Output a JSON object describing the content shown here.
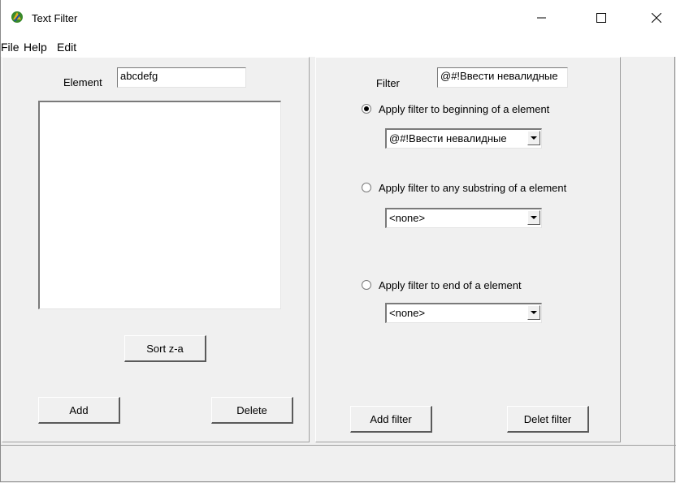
{
  "window": {
    "title": "Text Filter",
    "controls": {
      "minimize": "—",
      "maximize": "☐",
      "close": "✕"
    }
  },
  "menu": [
    "File",
    "Help",
    "Edit"
  ],
  "left": {
    "element_label": "Element",
    "element_value": "abcdefg",
    "sort_label": "Sort z-a",
    "add_label": "Add",
    "delete_label": "Delete"
  },
  "right": {
    "filter_label": "Filter",
    "filter_value": "@#!Ввести невалидные",
    "options": [
      {
        "label": "Apply filter to beginning of a element",
        "checked": true,
        "combo_value": "@#!Ввести невалидные"
      },
      {
        "label": "Apply filter to any substring of a element",
        "checked": false,
        "combo_value": "<none>"
      },
      {
        "label": "Apply filter to end of a element",
        "checked": false,
        "combo_value": "<none>"
      }
    ],
    "add_filter_label": "Add filter",
    "delete_filter_label": "Delet filter"
  },
  "icons": {
    "app": "app-icon",
    "dropdown": "chevron-down-icon"
  }
}
